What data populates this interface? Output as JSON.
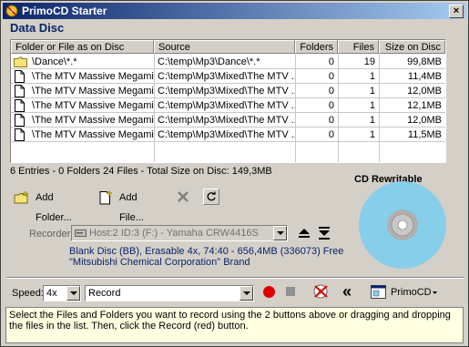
{
  "window": {
    "title": "PrimoCD Starter",
    "close_glyph": "×"
  },
  "section_title": "Data Disc",
  "table": {
    "headers": [
      "Folder or File as on Disc",
      "Source",
      "Folders",
      "Files",
      "Size on Disc"
    ],
    "rows": [
      {
        "name": "\\Dance\\*.*",
        "source": "C:\\temp\\Mp3\\Dance\\*.*",
        "folders": "0",
        "files": "19",
        "size": "99,8MB",
        "icon": "folder-icon"
      },
      {
        "name": "\\The MTV Massive Megamix...",
        "source": "C:\\temp\\Mp3\\Mixed\\The MTV ...",
        "folders": "0",
        "files": "1",
        "size": "11,4MB",
        "icon": "file-icon"
      },
      {
        "name": "\\The MTV Massive Megamix...",
        "source": "C:\\temp\\Mp3\\Mixed\\The MTV ...",
        "folders": "0",
        "files": "1",
        "size": "12,0MB",
        "icon": "file-icon"
      },
      {
        "name": "\\The MTV Massive Megamix...",
        "source": "C:\\temp\\Mp3\\Mixed\\The MTV ...",
        "folders": "0",
        "files": "1",
        "size": "12,1MB",
        "icon": "file-icon"
      },
      {
        "name": "\\The MTV Massive Megamix...",
        "source": "C:\\temp\\Mp3\\Mixed\\The MTV ...",
        "folders": "0",
        "files": "1",
        "size": "12,0MB",
        "icon": "file-icon"
      },
      {
        "name": "\\The MTV Massive Megamix...",
        "source": "C:\\temp\\Mp3\\Mixed\\The MTV ...",
        "folders": "0",
        "files": "1",
        "size": "11,5MB",
        "icon": "file-icon"
      }
    ]
  },
  "summary": "6 Entries  -  0 Folders  24 Files  -  Total Size on Disc: 149,3MB",
  "toolbar": {
    "add_folder": "Add Folder...",
    "add_file": "Add File...",
    "delete_icon": "x-delete-icon",
    "refresh_icon": "refresh-icon"
  },
  "cd": {
    "label": "CD Rewritable",
    "color": "#87ceeb"
  },
  "recorder": {
    "label": "Recorder:",
    "value": "Host:2 ID:3 (F:) - Yamaha CRW4416S",
    "info_line1": "Blank Disc (BB), Erasable 4x, 74:40 - 656,4MB (336073) Free",
    "info_line2": "\"Mitsubishi Chemical Corporation\" Brand"
  },
  "controls": {
    "speed_label": "Speed:",
    "speed_value": "4x",
    "mode_value": "Record",
    "collapse_glyph": "«",
    "app_menu_label": "PrimoCD"
  },
  "hint": "Select the Files and Folders you want to record using the 2 buttons above or dragging and dropping the files in the list. Then, click the Record (red) button.",
  "colors": {
    "title_start": "#0a246a",
    "title_end": "#a6caf0",
    "record_red": "#e00000",
    "info_blue": "#0a246a"
  }
}
